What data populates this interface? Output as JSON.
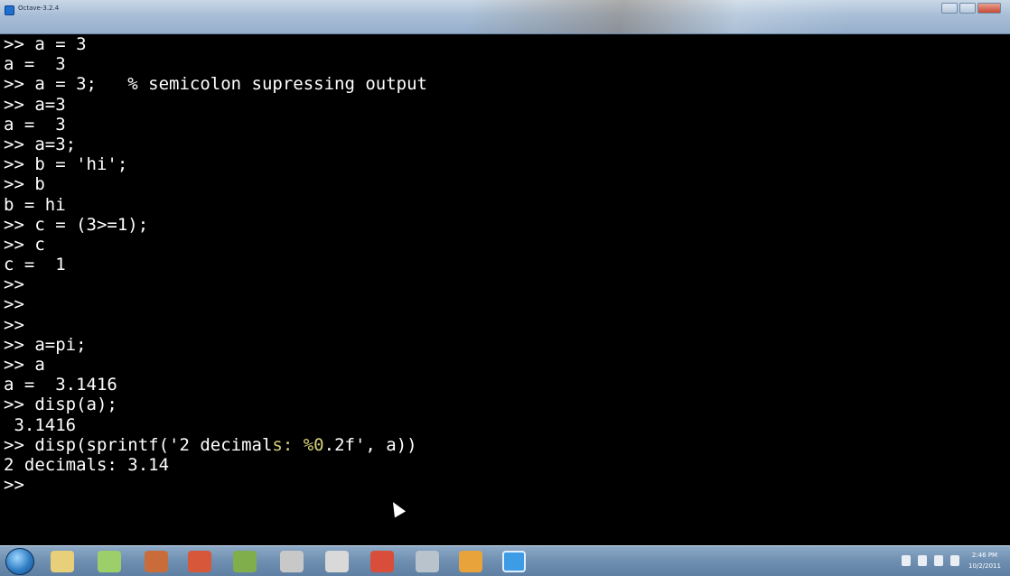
{
  "window": {
    "title": "Octave-3.2.4"
  },
  "terminal": {
    "lines": [
      ">> a = 3",
      "a =  3",
      ">> a = 3;   % semicolon supressing output",
      ">> a=3",
      "a =  3",
      ">> a=3;",
      ">> b = 'hi';",
      ">> b",
      "b = hi",
      ">> c = (3>=1);",
      ">> c",
      "c =  1",
      ">>",
      ">>",
      ">>",
      ">> a=pi;",
      ">> a",
      "a =  3.1416",
      ">> disp(a);",
      " 3.1416",
      ">> disp(sprintf('2 decimals: %0.2f', a))",
      "2 decimals: 3.14",
      ">>"
    ],
    "highlight": {
      "line_index": 20,
      "before": ">> disp(sprintf('2 decimal",
      "middle": "s: %0",
      "after": ".2f', a))"
    }
  },
  "taskbar": {
    "icons": [
      {
        "name": "explorer-icon",
        "color": "#e8d07a"
      },
      {
        "name": "media-icon",
        "color": "#9ccf6a"
      },
      {
        "name": "tools-icon",
        "color": "#c96c3a"
      },
      {
        "name": "powerpoint-icon",
        "color": "#d6573a"
      },
      {
        "name": "network-icon",
        "color": "#7fae4b"
      },
      {
        "name": "usb-icon",
        "color": "#c8c8c8"
      },
      {
        "name": "device-icon",
        "color": "#d9d9d9"
      },
      {
        "name": "chrome-icon",
        "color": "#d84e3a"
      },
      {
        "name": "search-icon",
        "color": "#b9c3cc"
      },
      {
        "name": "paint-icon",
        "color": "#e9a33b"
      },
      {
        "name": "octave-icon",
        "color": "#3e9be6"
      }
    ],
    "clock_time": "2:46 PM",
    "clock_date": "10/2/2011"
  }
}
